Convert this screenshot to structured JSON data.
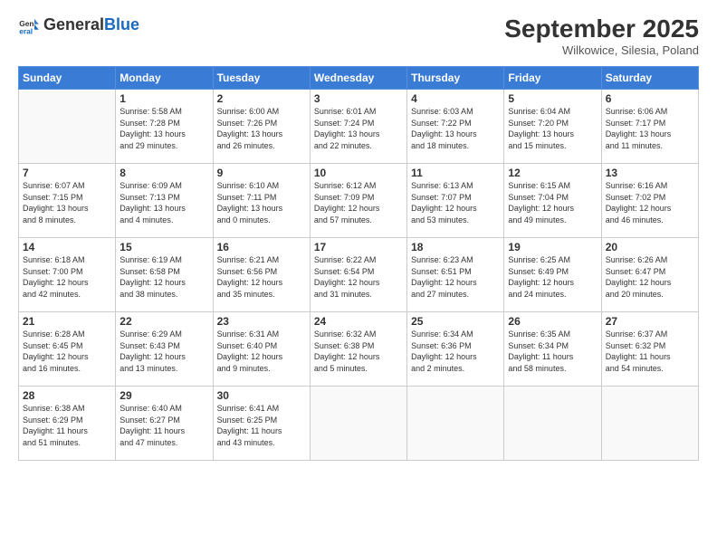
{
  "logo": {
    "line1": "General",
    "line2": "Blue"
  },
  "title": "September 2025",
  "location": "Wilkowice, Silesia, Poland",
  "weekdays": [
    "Sunday",
    "Monday",
    "Tuesday",
    "Wednesday",
    "Thursday",
    "Friday",
    "Saturday"
  ],
  "weeks": [
    [
      {
        "day": "",
        "info": ""
      },
      {
        "day": "1",
        "info": "Sunrise: 5:58 AM\nSunset: 7:28 PM\nDaylight: 13 hours\nand 29 minutes."
      },
      {
        "day": "2",
        "info": "Sunrise: 6:00 AM\nSunset: 7:26 PM\nDaylight: 13 hours\nand 26 minutes."
      },
      {
        "day": "3",
        "info": "Sunrise: 6:01 AM\nSunset: 7:24 PM\nDaylight: 13 hours\nand 22 minutes."
      },
      {
        "day": "4",
        "info": "Sunrise: 6:03 AM\nSunset: 7:22 PM\nDaylight: 13 hours\nand 18 minutes."
      },
      {
        "day": "5",
        "info": "Sunrise: 6:04 AM\nSunset: 7:20 PM\nDaylight: 13 hours\nand 15 minutes."
      },
      {
        "day": "6",
        "info": "Sunrise: 6:06 AM\nSunset: 7:17 PM\nDaylight: 13 hours\nand 11 minutes."
      }
    ],
    [
      {
        "day": "7",
        "info": "Sunrise: 6:07 AM\nSunset: 7:15 PM\nDaylight: 13 hours\nand 8 minutes."
      },
      {
        "day": "8",
        "info": "Sunrise: 6:09 AM\nSunset: 7:13 PM\nDaylight: 13 hours\nand 4 minutes."
      },
      {
        "day": "9",
        "info": "Sunrise: 6:10 AM\nSunset: 7:11 PM\nDaylight: 13 hours\nand 0 minutes."
      },
      {
        "day": "10",
        "info": "Sunrise: 6:12 AM\nSunset: 7:09 PM\nDaylight: 12 hours\nand 57 minutes."
      },
      {
        "day": "11",
        "info": "Sunrise: 6:13 AM\nSunset: 7:07 PM\nDaylight: 12 hours\nand 53 minutes."
      },
      {
        "day": "12",
        "info": "Sunrise: 6:15 AM\nSunset: 7:04 PM\nDaylight: 12 hours\nand 49 minutes."
      },
      {
        "day": "13",
        "info": "Sunrise: 6:16 AM\nSunset: 7:02 PM\nDaylight: 12 hours\nand 46 minutes."
      }
    ],
    [
      {
        "day": "14",
        "info": "Sunrise: 6:18 AM\nSunset: 7:00 PM\nDaylight: 12 hours\nand 42 minutes."
      },
      {
        "day": "15",
        "info": "Sunrise: 6:19 AM\nSunset: 6:58 PM\nDaylight: 12 hours\nand 38 minutes."
      },
      {
        "day": "16",
        "info": "Sunrise: 6:21 AM\nSunset: 6:56 PM\nDaylight: 12 hours\nand 35 minutes."
      },
      {
        "day": "17",
        "info": "Sunrise: 6:22 AM\nSunset: 6:54 PM\nDaylight: 12 hours\nand 31 minutes."
      },
      {
        "day": "18",
        "info": "Sunrise: 6:23 AM\nSunset: 6:51 PM\nDaylight: 12 hours\nand 27 minutes."
      },
      {
        "day": "19",
        "info": "Sunrise: 6:25 AM\nSunset: 6:49 PM\nDaylight: 12 hours\nand 24 minutes."
      },
      {
        "day": "20",
        "info": "Sunrise: 6:26 AM\nSunset: 6:47 PM\nDaylight: 12 hours\nand 20 minutes."
      }
    ],
    [
      {
        "day": "21",
        "info": "Sunrise: 6:28 AM\nSunset: 6:45 PM\nDaylight: 12 hours\nand 16 minutes."
      },
      {
        "day": "22",
        "info": "Sunrise: 6:29 AM\nSunset: 6:43 PM\nDaylight: 12 hours\nand 13 minutes."
      },
      {
        "day": "23",
        "info": "Sunrise: 6:31 AM\nSunset: 6:40 PM\nDaylight: 12 hours\nand 9 minutes."
      },
      {
        "day": "24",
        "info": "Sunrise: 6:32 AM\nSunset: 6:38 PM\nDaylight: 12 hours\nand 5 minutes."
      },
      {
        "day": "25",
        "info": "Sunrise: 6:34 AM\nSunset: 6:36 PM\nDaylight: 12 hours\nand 2 minutes."
      },
      {
        "day": "26",
        "info": "Sunrise: 6:35 AM\nSunset: 6:34 PM\nDaylight: 11 hours\nand 58 minutes."
      },
      {
        "day": "27",
        "info": "Sunrise: 6:37 AM\nSunset: 6:32 PM\nDaylight: 11 hours\nand 54 minutes."
      }
    ],
    [
      {
        "day": "28",
        "info": "Sunrise: 6:38 AM\nSunset: 6:29 PM\nDaylight: 11 hours\nand 51 minutes."
      },
      {
        "day": "29",
        "info": "Sunrise: 6:40 AM\nSunset: 6:27 PM\nDaylight: 11 hours\nand 47 minutes."
      },
      {
        "day": "30",
        "info": "Sunrise: 6:41 AM\nSunset: 6:25 PM\nDaylight: 11 hours\nand 43 minutes."
      },
      {
        "day": "",
        "info": ""
      },
      {
        "day": "",
        "info": ""
      },
      {
        "day": "",
        "info": ""
      },
      {
        "day": "",
        "info": ""
      }
    ]
  ]
}
